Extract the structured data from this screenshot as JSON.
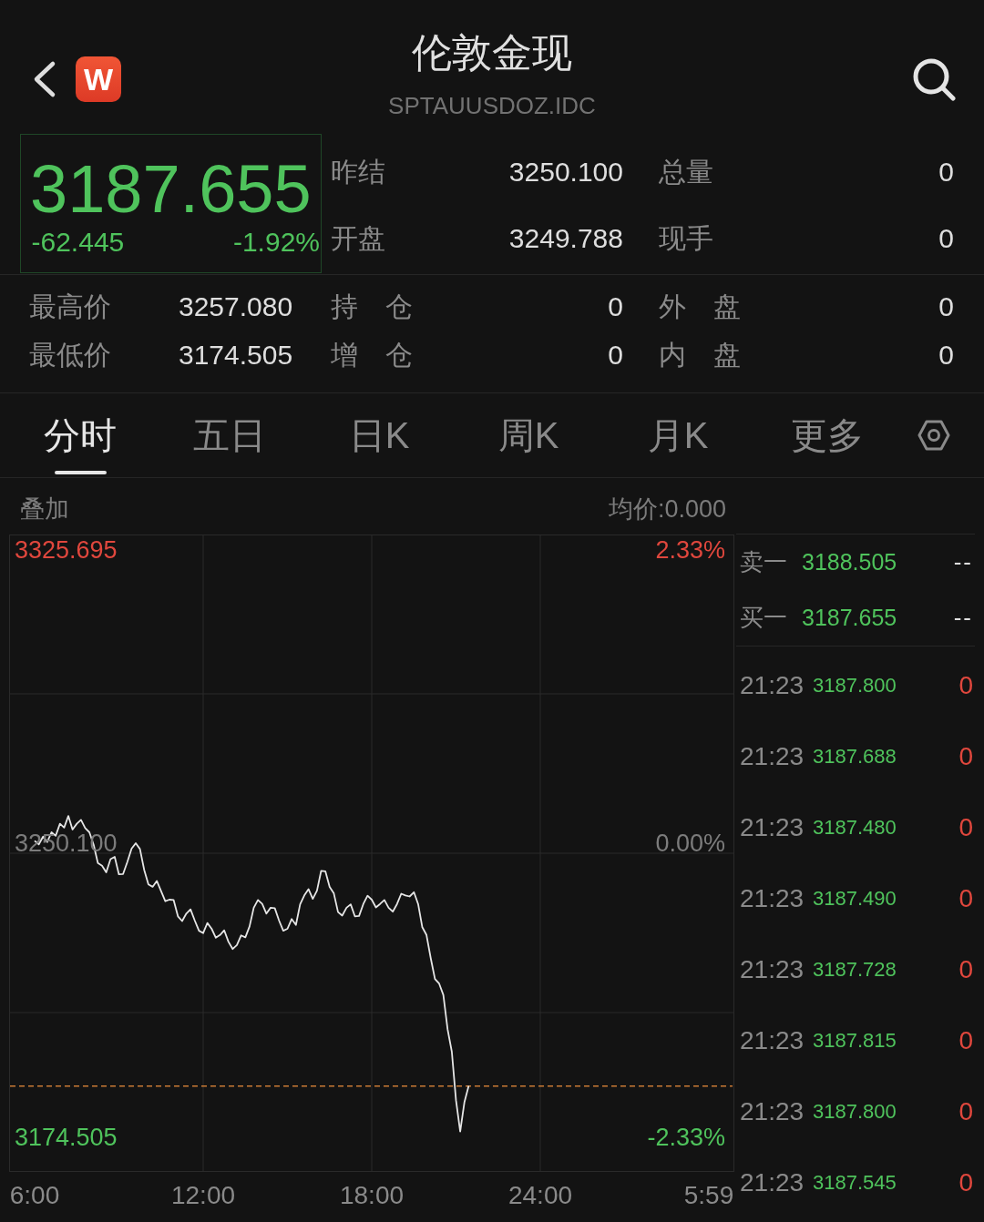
{
  "header": {
    "logo_text": "W",
    "title": "伦敦金现",
    "code": "SPTAUUSDOZ.IDC"
  },
  "quote": {
    "price": "3187.655",
    "change": "-62.445",
    "change_percent": "-1.92%",
    "rising": false,
    "fields": [
      {
        "label": "昨结",
        "value": "3250.100"
      },
      {
        "label": "总量",
        "value": "0"
      },
      {
        "label": "开盘",
        "value": "3249.788"
      },
      {
        "label": "现手",
        "value": "0"
      }
    ]
  },
  "stats": [
    {
      "label": "最高价",
      "value": "3257.080"
    },
    {
      "label": "持　仓",
      "value": "0"
    },
    {
      "label": "外　盘",
      "value": "0"
    },
    {
      "label": "最低价",
      "value": "3174.505"
    },
    {
      "label": "增　仓",
      "value": "0"
    },
    {
      "label": "内　盘",
      "value": "0"
    }
  ],
  "tabs": [
    {
      "label": "分时",
      "selected": true
    },
    {
      "label": "五日",
      "selected": false
    },
    {
      "label": "日K",
      "selected": false
    },
    {
      "label": "周K",
      "selected": false
    },
    {
      "label": "月K",
      "selected": false
    },
    {
      "label": "更多",
      "selected": false
    }
  ],
  "chart": {
    "overlay": "叠加",
    "average_price": "均价:0.000",
    "percent_labels": [
      "2.33%",
      "0.00%",
      "-2.33%"
    ],
    "chart_data": {
      "type": "line",
      "categories": [
        "6:00",
        null,
        null,
        null,
        null,
        null,
        null,
        null,
        null,
        null,
        null,
        null,
        null,
        null,
        null,
        null,
        null,
        null,
        null,
        null,
        null,
        null,
        null,
        null,
        null,
        null,
        null,
        null,
        null,
        null,
        null,
        null,
        null,
        null,
        null,
        null,
        null,
        null,
        null,
        null,
        "12:00",
        null,
        null,
        null,
        null,
        null,
        null,
        null,
        null,
        null,
        null,
        null,
        null,
        null,
        null,
        null,
        null,
        null,
        null,
        null,
        null,
        null,
        null,
        null,
        null,
        null,
        null,
        null,
        null,
        null,
        null,
        null,
        null,
        null,
        null,
        null,
        null,
        null,
        null,
        null,
        "18:00",
        null,
        null,
        null,
        null,
        null,
        null,
        null,
        null,
        null,
        null,
        null,
        null,
        null,
        null,
        null,
        null,
        null,
        null,
        null,
        null,
        null,
        null,
        null,
        null,
        null,
        null,
        null,
        null,
        null,
        null,
        null,
        null,
        null,
        null,
        null,
        null,
        null,
        null,
        null,
        "24:00",
        null,
        null,
        null,
        null,
        null,
        null,
        null,
        null,
        null,
        null,
        null,
        null,
        null,
        null,
        null,
        null,
        null,
        null,
        null,
        null,
        null,
        null,
        null,
        null,
        null,
        null,
        null,
        null,
        null,
        null,
        null,
        null,
        null,
        null,
        null,
        null,
        null,
        null,
        null,
        "5:59"
      ],
      "series": [
        {
          "color": "#e6e6e6",
          "values": [
            3250.7,
            3249.8,
            3251.8,
            3250.4,
            3252.9,
            3252.0,
            3255.1,
            3254.1,
            3257.1,
            3253.6,
            3255.1,
            3256.1,
            3254.0,
            3252.9,
            3249.7,
            3245.0,
            3244.3,
            3242.6,
            3246.0,
            3246.6,
            3242.1,
            3242.2,
            3245.3,
            3248.7,
            3250.1,
            3248.6,
            3243.2,
            3239.5,
            3238.9,
            3240.4,
            3237.8,
            3235.2,
            3235.6,
            3235.5,
            3231.3,
            3230.1,
            3232.0,
            3233.1,
            3230.2,
            3227.6,
            3227.0,
            3229.6,
            3228.1,
            3225.8,
            3226.5,
            3227.7,
            3224.8,
            3222.9,
            3223.9,
            3226.4,
            3225.9,
            3228.7,
            3233.5,
            3235.5,
            3234.5,
            3232.0,
            3233.5,
            3233.4,
            3230.2,
            3227.6,
            3228.1,
            3230.6,
            3229.1,
            3234.4,
            3236.7,
            3238.3,
            3235.8,
            3237.9,
            3243.0,
            3242.9,
            3238.9,
            3237.2,
            3232.4,
            3231.5,
            3233.5,
            3234.4,
            3231.3,
            3231.4,
            3234.5,
            3236.6,
            3235.6,
            3233.6,
            3234.5,
            3235.5,
            3233.5,
            3232.5,
            3234.5,
            3237.1,
            3236.7,
            3236.4,
            3237.5,
            3234.5,
            3228.5,
            3226.5,
            3220.5,
            3215.2,
            3214.0,
            3211.1,
            3202.2,
            3196.5,
            3184.0,
            3176.0,
            3183.5,
            3187.7,
            null,
            null,
            null,
            null,
            null,
            null,
            null,
            null,
            null,
            null,
            null,
            null,
            null,
            null,
            null,
            null,
            null,
            null,
            null,
            null,
            null,
            null,
            null,
            null,
            null,
            null,
            null,
            null,
            null,
            null,
            null,
            null,
            null,
            null,
            null,
            null,
            null,
            null,
            null,
            null,
            null,
            null,
            null,
            null,
            null,
            null,
            null,
            null,
            null,
            null,
            null,
            null,
            null,
            null,
            null,
            null,
            null
          ]
        }
      ],
      "ylim": [
        3165.61,
        3329.44
      ],
      "yticks": [
        {
          "value": 3325.695,
          "label": "3325.695"
        },
        {
          "value": 3250.1,
          "label": "3250.100"
        },
        {
          "value": 3174.505,
          "label": "3174.505"
        }
      ],
      "ref_lines": [
        {
          "axis": "y",
          "value": 3187.655,
          "color": "#c97a34"
        }
      ]
    }
  },
  "order_book": [
    {
      "label": "卖一",
      "price": "3188.505",
      "volume": "--"
    },
    {
      "label": "买一",
      "price": "3187.655",
      "volume": "--"
    }
  ],
  "trades": [
    {
      "time": "21:23",
      "price": "3187.800",
      "volume": "0"
    },
    {
      "time": "21:23",
      "price": "3187.688",
      "volume": "0"
    },
    {
      "time": "21:23",
      "price": "3187.480",
      "volume": "0"
    },
    {
      "time": "21:23",
      "price": "3187.490",
      "volume": "0"
    },
    {
      "time": "21:23",
      "price": "3187.728",
      "volume": "0"
    },
    {
      "time": "21:23",
      "price": "3187.815",
      "volume": "0"
    },
    {
      "time": "21:23",
      "price": "3187.800",
      "volume": "0"
    },
    {
      "time": "21:23",
      "price": "3187.545",
      "volume": "0"
    }
  ]
}
